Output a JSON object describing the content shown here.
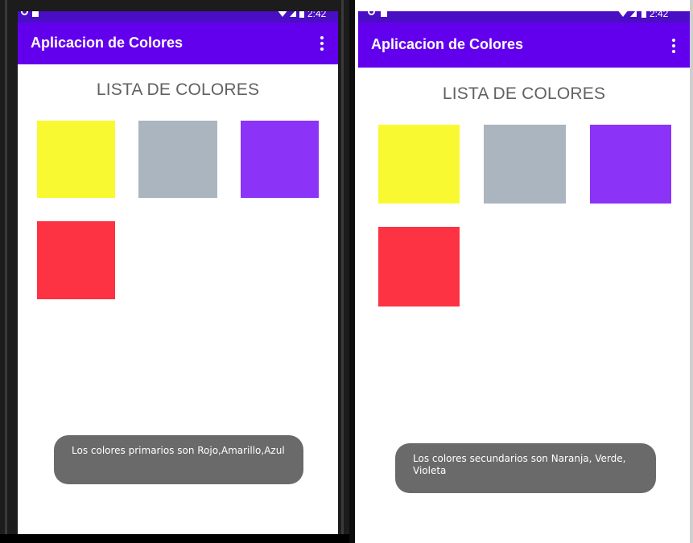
{
  "status_bar": {
    "time": "2:42"
  },
  "screens": [
    {
      "app_title": "Aplicacion de Colores",
      "list_title": "LISTA DE COLORES",
      "swatches": [
        {
          "color": "#f9f932",
          "name": "yellow"
        },
        {
          "color": "#aab5bf",
          "name": "gray"
        },
        {
          "color": "#8b33f7",
          "name": "purple"
        },
        {
          "color": "#fd3242",
          "name": "red"
        }
      ],
      "toast": "Los colores primarios son Rojo,Amarillo,Azul"
    },
    {
      "app_title": "Aplicacion de Colores",
      "list_title": "LISTA DE COLORES",
      "swatches": [
        {
          "color": "#f9f932",
          "name": "yellow"
        },
        {
          "color": "#aab5bf",
          "name": "gray"
        },
        {
          "color": "#8b33f7",
          "name": "purple"
        },
        {
          "color": "#fd3242",
          "name": "red"
        }
      ],
      "toast": "Los colores secundarios son Naranja, Verde, Violeta"
    }
  ],
  "colors": {
    "appbar": "#6200ee",
    "statusbar": "#4a0ec4",
    "toast_bg": "#6a6a6a",
    "title_text": "#616161"
  }
}
